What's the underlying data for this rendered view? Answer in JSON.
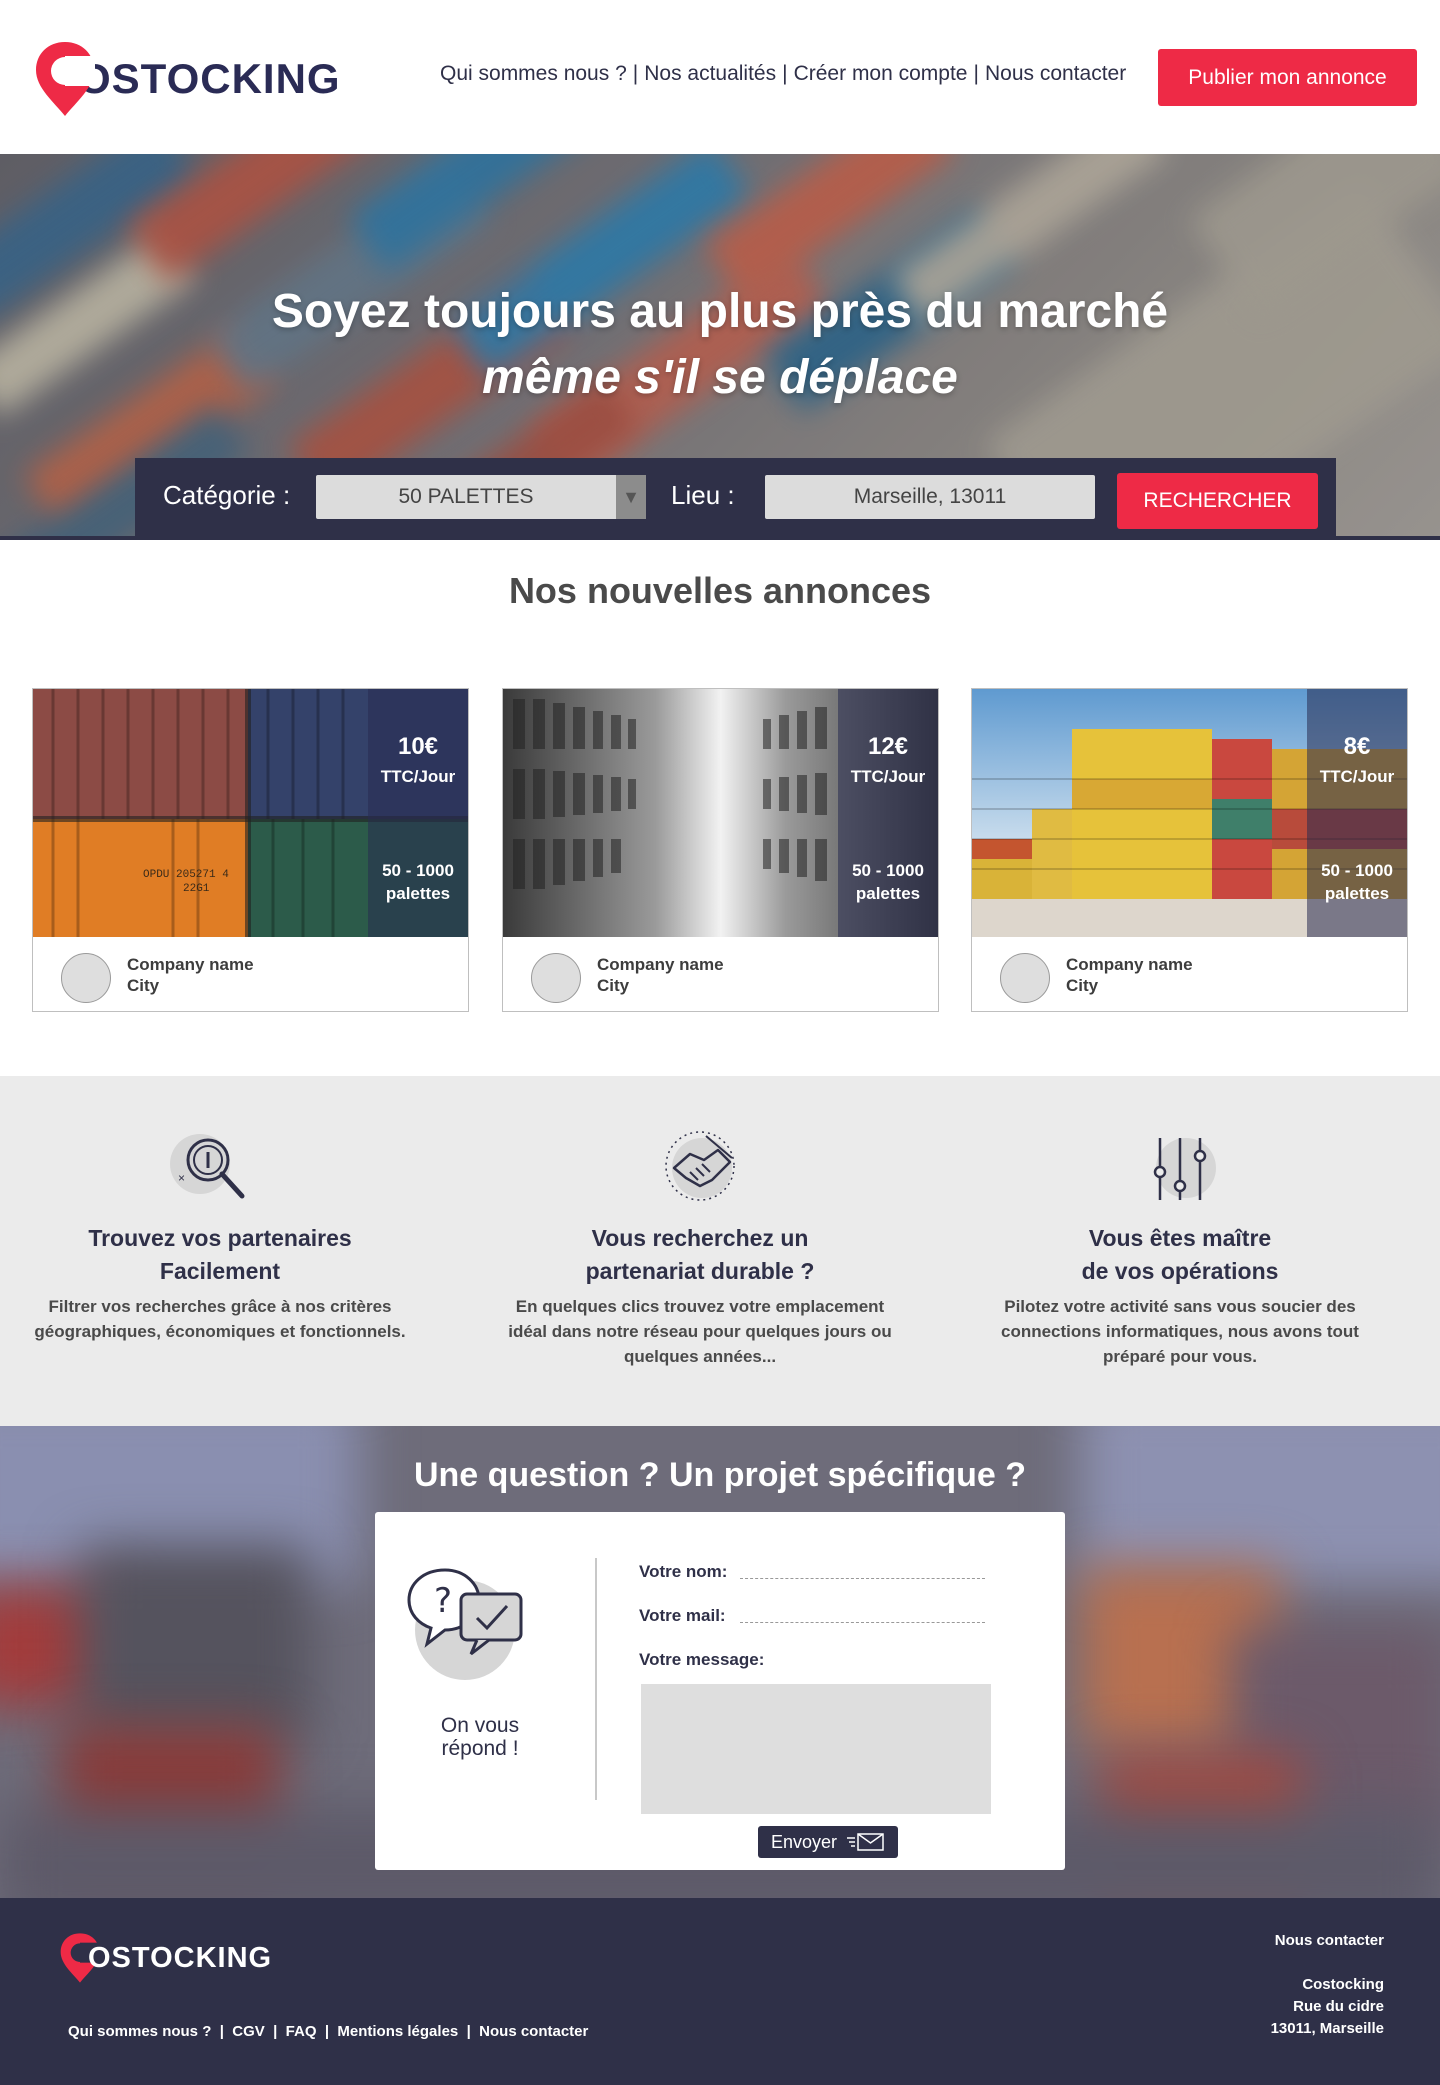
{
  "brand": {
    "name": "OSTOCKING",
    "accent_color": "#ee2a46",
    "dark_color": "#2f3048"
  },
  "nav": {
    "items": [
      "Qui sommes nous ?",
      "Nos actualités",
      "Créer mon compte",
      "Nous contacter"
    ],
    "separator": "|",
    "publish_label": "Publier mon annonce"
  },
  "hero": {
    "title": "Soyez toujours au plus près du marché",
    "subtitle": "même s'il se déplace",
    "category_label": "Catégorie :",
    "category_value": "50 PALETTES",
    "location_label": "Lieu :",
    "location_value": "Marseille, 13011",
    "search_label": "RECHERCHER"
  },
  "ads": {
    "title": "Nos nouvelles annonces",
    "items": [
      {
        "price": "10€",
        "unit": "TTC/Jour",
        "qty_line1": "50 - 1000",
        "qty_line2": "palettes",
        "company": "Company name",
        "city": "City"
      },
      {
        "price": "12€",
        "unit": "TTC/Jour",
        "qty_line1": "50 - 1000",
        "qty_line2": "palettes",
        "company": "Company name",
        "city": "City"
      },
      {
        "price": "8€",
        "unit": "TTC/Jour",
        "qty_line1": "50 - 1000",
        "qty_line2": "palettes",
        "company": "Company name",
        "city": "City"
      }
    ]
  },
  "features": [
    {
      "icon": "search-magnifier-icon",
      "title_1": "Trouvez vos partenaires",
      "title_2": "Facilement",
      "desc_1": "Filtrer vos recherches grâce à nos critères",
      "desc_2": "géographiques, économiques et fonctionnels.",
      "desc_3": ""
    },
    {
      "icon": "handshake-icon",
      "title_1": "Vous recherchez un",
      "title_2": "partenariat durable ?",
      "desc_1": "En quelques clics trouvez votre emplacement",
      "desc_2": "idéal dans notre réseau pour quelques jours ou",
      "desc_3": "quelques années..."
    },
    {
      "icon": "sliders-icon",
      "title_1": "Vous êtes maître",
      "title_2": "de vos opérations",
      "desc_1": "Pilotez votre activité sans vous soucier des",
      "desc_2": "connections informatiques, nous avons tout",
      "desc_3": "préparé pour vous."
    }
  ],
  "contact": {
    "title": "Une question ? Un projet spécifique ?",
    "answer_1": "On vous",
    "answer_2": "répond !",
    "name_label": "Votre nom:",
    "mail_label": "Votre mail:",
    "message_label": "Votre message:",
    "send_label": "Envoyer"
  },
  "footer": {
    "logo_text": "OSTOCKING",
    "links": [
      "Qui sommes nous ?",
      "CGV",
      "FAQ",
      "Mentions légales",
      "Nous contacter"
    ],
    "contact_title": "Nous contacter",
    "company": "Costocking",
    "street": "Rue du cidre",
    "city": "13011, Marseille"
  }
}
